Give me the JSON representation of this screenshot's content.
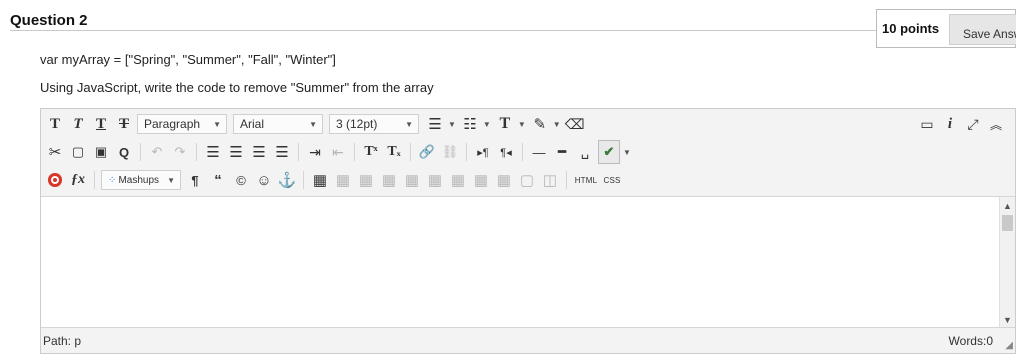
{
  "question": {
    "title": "Question 2",
    "points": "10 points",
    "save_label": "Save Answer"
  },
  "prompt": {
    "code_line": "var myArray = [\"Spring\", \"Summer\", \"Fall\", \"Winter\"]",
    "instruction": "Using JavaScript, write the code to remove \"Summer\" from the array"
  },
  "toolbar": {
    "format_select": "Paragraph",
    "font_select": "Arial",
    "size_select": "3 (12pt)",
    "mashups_label": "Mashups",
    "glyphs": {
      "bold": "T",
      "italic": "T",
      "underline": "T",
      "strike": "T",
      "superscript": "Tˣ",
      "subscript": "Tₓ",
      "text_color": "T",
      "pilcrow": "¶",
      "quote": "“",
      "copyright": "©",
      "smiley": "☺",
      "anchor": "⚓",
      "fx": "ƒx",
      "html": "HTML",
      "css": "CSS",
      "info": "i",
      "spellcheck": "✔",
      "clear_format": "⌫"
    }
  },
  "status": {
    "path_label": "Path: p",
    "words": "Words:0"
  },
  "colors": {
    "accent": "#333333",
    "toolbar_bg": "#f3f3f3",
    "mashup_red": "#d9352b",
    "mashup_blue": "#2a7fd4",
    "mashup_green": "#3aa35b"
  }
}
